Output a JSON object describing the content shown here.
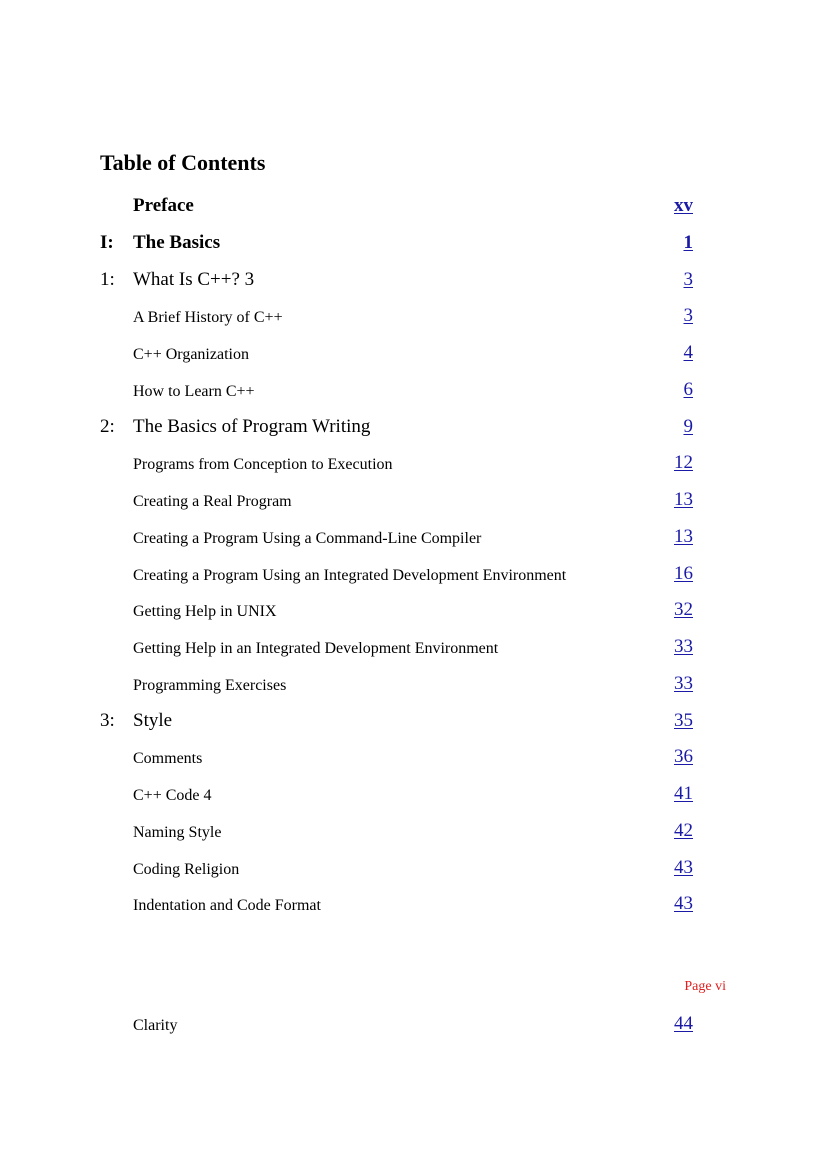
{
  "document": {
    "title": "Table of Contents",
    "page_marker": "Page vi",
    "colors": {
      "link": "#1a1aa6",
      "page_marker": "#e02020"
    },
    "entries": [
      {
        "level": "part",
        "number": "",
        "label": "Preface",
        "page": "xv"
      },
      {
        "level": "part",
        "number": "I:",
        "label": "The Basics",
        "page": "1"
      },
      {
        "level": "chapter",
        "number": "1:",
        "label": "What Is C++? 3",
        "page": "3"
      },
      {
        "level": "section",
        "number": "",
        "label": "A Brief History of C++",
        "page": "3"
      },
      {
        "level": "section",
        "number": "",
        "label": "C++ Organization",
        "page": "4"
      },
      {
        "level": "section",
        "number": "",
        "label": "How to Learn C++",
        "page": "6"
      },
      {
        "level": "chapter",
        "number": "2:",
        "label": "The Basics of Program Writing",
        "page": "9"
      },
      {
        "level": "section",
        "number": "",
        "label": "Programs from Conception to Execution",
        "page": "12"
      },
      {
        "level": "section",
        "number": "",
        "label": "Creating a Real Program",
        "page": "13"
      },
      {
        "level": "section",
        "number": "",
        "label": "Creating a Program Using a Command-Line Compiler",
        "page": "13"
      },
      {
        "level": "section",
        "number": "",
        "label": "Creating a Program Using an Integrated Development Environment",
        "page": "16"
      },
      {
        "level": "section",
        "number": "",
        "label": "Getting Help in UNIX",
        "page": "32"
      },
      {
        "level": "section",
        "number": "",
        "label": "Getting Help in an Integrated Development Environment",
        "page": "33"
      },
      {
        "level": "section",
        "number": "",
        "label": "Programming Exercises",
        "page": "33"
      },
      {
        "level": "chapter",
        "number": "3:",
        "label": "Style",
        "page": "35"
      },
      {
        "level": "section",
        "number": "",
        "label": "Comments",
        "page": "36"
      },
      {
        "level": "section",
        "number": "",
        "label": "C++ Code 4",
        "page": "41"
      },
      {
        "level": "section",
        "number": "",
        "label": "Naming Style",
        "page": "42"
      },
      {
        "level": "section",
        "number": "",
        "label": "Coding Religion",
        "page": "43"
      },
      {
        "level": "section",
        "number": "",
        "label": "Indentation and Code Format",
        "page": "43"
      }
    ],
    "continued_entries": [
      {
        "level": "section",
        "number": "",
        "label": "Clarity",
        "page": "44"
      }
    ]
  }
}
